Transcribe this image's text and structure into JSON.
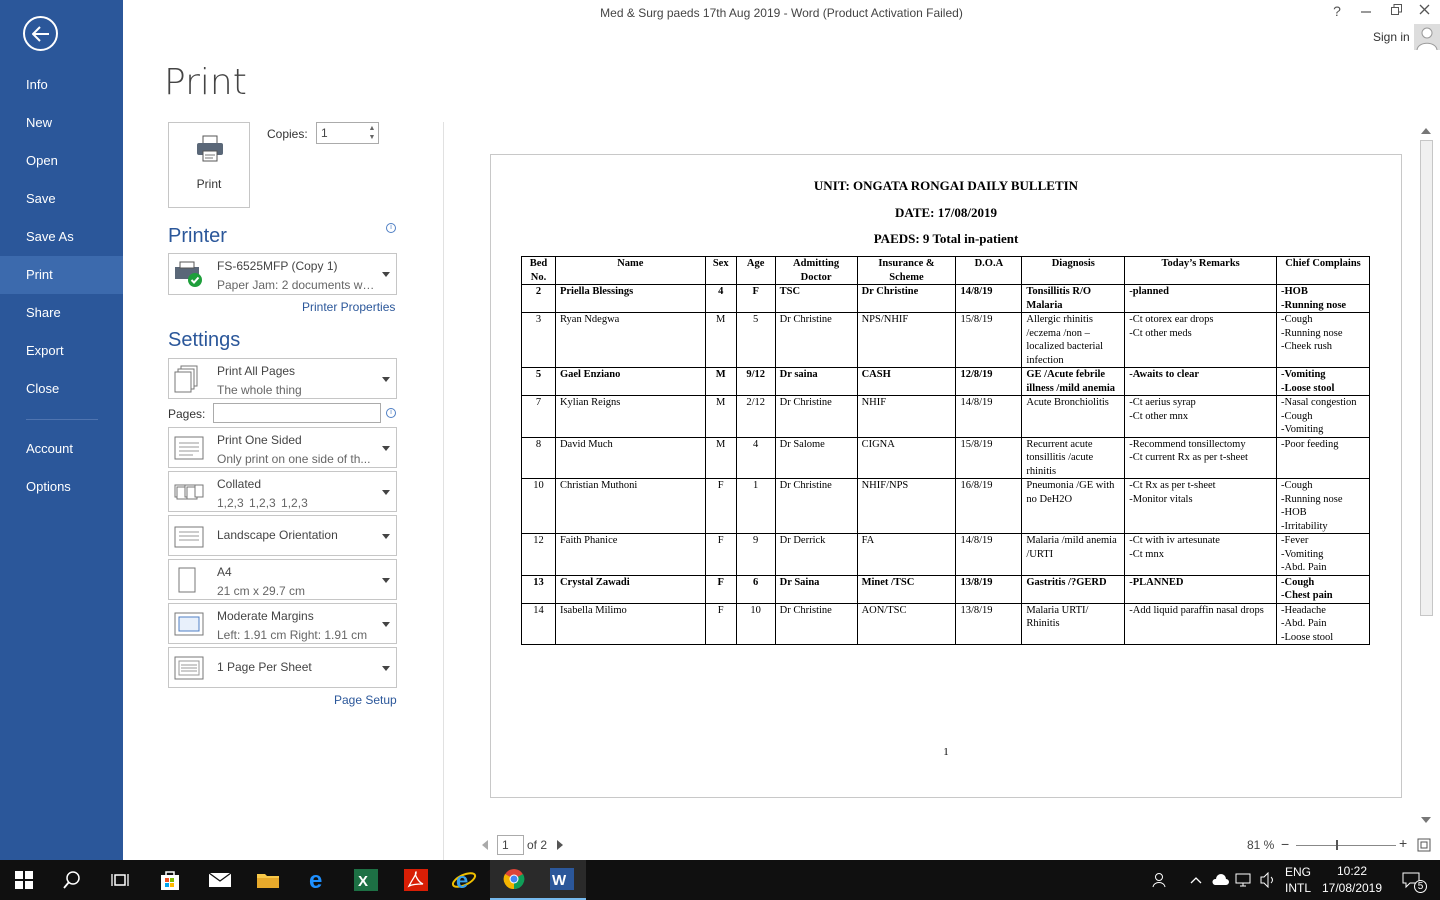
{
  "window": {
    "title": "Med & Surg paeds 17th Aug  2019 - Word (Product Activation Failed)",
    "help": "?",
    "sign_in": "Sign in"
  },
  "sidebar": {
    "items": [
      {
        "label": "Info"
      },
      {
        "label": "New"
      },
      {
        "label": "Open"
      },
      {
        "label": "Save"
      },
      {
        "label": "Save As"
      },
      {
        "label": "Print"
      },
      {
        "label": "Share"
      },
      {
        "label": "Export"
      },
      {
        "label": "Close"
      },
      {
        "label": "Account"
      },
      {
        "label": "Options"
      }
    ],
    "active": "Print",
    "color": "#2b579a"
  },
  "print_panel": {
    "title": "Print",
    "print_button": "Print",
    "copies_label": "Copies:",
    "copies_value": "1",
    "printer_heading": "Printer",
    "printer_name": "FS-6525MFP (Copy 1)",
    "printer_status": "Paper Jam: 2 documents wai...",
    "printer_properties": "Printer Properties",
    "settings_heading": "Settings",
    "pages_label": "Pages:",
    "pages_value": "",
    "settings": [
      {
        "line1": "Print All Pages",
        "line2": "The whole thing",
        "icon": "pages-icon"
      },
      {
        "line1": "Print One Sided",
        "line2": "Only print on one side of th...",
        "icon": "one-sided-icon"
      },
      {
        "line1": "Collated",
        "line2": "1,2,3    1,2,3    1,2,3",
        "icon": "collated-icon"
      },
      {
        "line1": "Landscape Orientation",
        "line2": "",
        "icon": "landscape-icon"
      },
      {
        "line1": "A4",
        "line2": "21 cm x 29.7 cm",
        "icon": "paper-size-icon"
      },
      {
        "line1": "Moderate Margins",
        "line2": "Left:  1.91 cm    Right:  1.91 cm",
        "icon": "margins-icon"
      },
      {
        "line1": "1 Page Per Sheet",
        "line2": "",
        "icon": "pages-per-sheet-icon"
      }
    ],
    "page_setup": "Page Setup"
  },
  "document": {
    "heading1": "UNIT: ONGATA RONGAI DAILY BULLETIN",
    "heading2": "DATE: 17/08/2019",
    "heading3": "PAEDS: 9 Total in-patient",
    "columns": [
      "Bed No.",
      "Name",
      "Sex",
      "Age",
      "Admitting Doctor",
      "Insurance & Scheme",
      "D.O.A",
      "Diagnosis",
      "Today’s Remarks",
      "Chief Complains"
    ],
    "rows": [
      {
        "bold": true,
        "cells": [
          "2",
          "Priella    Blessings",
          "4",
          "F",
          "TSC",
          "Dr  Christine",
          "14/8/19",
          "Tonsillitis  R/O Malaria",
          "-planned",
          "-HOB\n-Running  nose"
        ]
      },
      {
        "bold": false,
        "cells": [
          "3",
          "Ryan   Ndegwa",
          "M",
          "5",
          "Dr  Christine",
          "NPS/NHIF",
          "15/8/19",
          "Allergic  rhinitis /eczema /non – localized bacterial infection",
          "-Ct  otorex   ear  drops\n-Ct  other  meds",
          "-Cough\n-Running nose\n-Cheek rush"
        ]
      },
      {
        "bold": true,
        "cells": [
          "5",
          "Gael Enziano",
          "M",
          "9/12",
          "Dr saina",
          "CASH",
          "12/8/19",
          "GE /Acute febrile illness /mild anemia",
          "-Awaits  to clear",
          "-Vomiting\n-Loose stool"
        ]
      },
      {
        "bold": false,
        "cells": [
          "7",
          "Kylian  Reigns",
          "M",
          "2/12",
          "Dr  Christine",
          "NHIF",
          "14/8/19",
          "Acute Bronchiolitis",
          "-Ct  aerius  syrap\n-Ct   other  mnx",
          "-Nasal congestion\n-Cough\n-Vomiting"
        ]
      },
      {
        "bold": false,
        "cells": [
          "8",
          "David   Much",
          "M",
          "4",
          "Dr  Salome",
          "CIGNA",
          "15/8/19",
          "Recurrent  acute tonsillitis /acute rhinitis",
          "-Recommend tonsillectomy\n-Ct  current  Rx as  per t-sheet",
          "-Poor  feeding"
        ]
      },
      {
        "bold": false,
        "cells": [
          "10",
          "Christian  Muthoni",
          "F",
          "1",
          "Dr  Christine",
          "NHIF/NPS",
          "16/8/19",
          "Pneumonia /GE with  no  DeH2O",
          "-Ct  Rx as per t-sheet\n-Monitor  vitals",
          "-Cough\n-Running  nose\n-HOB\n-Irritability"
        ]
      },
      {
        "bold": false,
        "cells": [
          "12",
          "Faith   Phanice",
          "F",
          "9",
          "Dr  Derrick",
          "FA",
          "14/8/19",
          "Malaria /mild anemia /URTI",
          "-Ct   with  iv  artesunate\n-Ct  mnx",
          "-Fever\n-Vomiting\n-Abd.  Pain"
        ]
      },
      {
        "bold": true,
        "cells": [
          "13",
          "Crystal  Zawadi",
          "F",
          "6",
          "Dr  Saina",
          "Minet /TSC",
          "13/8/19",
          "Gastritis /?GERD",
          "-PLANNED",
          "-Cough\n-Chest  pain"
        ]
      },
      {
        "bold": false,
        "cells": [
          "14",
          "Isabella Milimo",
          "F",
          "10",
          "Dr    Christine",
          "AON/TSC",
          "13/8/19",
          "Malaria URTI/ Rhinitis",
          "-Add  liquid  paraffin nasal drops",
          "-Headache\n-Abd.  Pain\n-Loose  stool"
        ]
      }
    ],
    "page_number": "1"
  },
  "status": {
    "current_page": "1",
    "of_pages": "of 2",
    "zoom": "81 %"
  },
  "taskbar": {
    "language": "ENG",
    "layout": "INTL",
    "time": "10:22",
    "date": "17/08/2019",
    "notifications": "5",
    "color": "#101010"
  }
}
